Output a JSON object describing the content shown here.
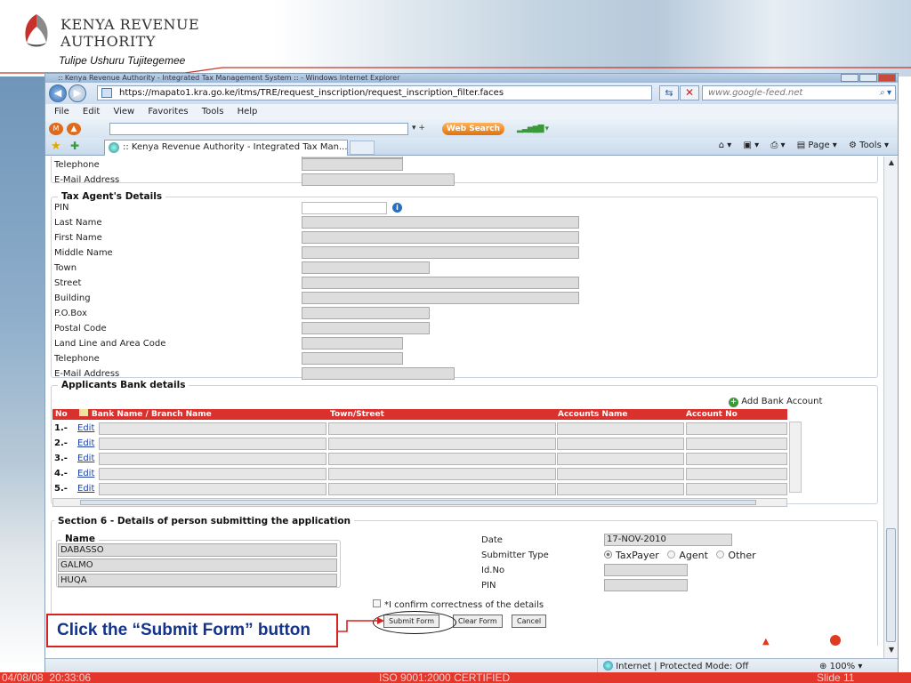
{
  "slide": {
    "org_name_line1": "Kenya Revenue",
    "org_name_line2": "Authority",
    "slogan": "Tulipe Ushuru Tujitegemee",
    "footer_date": "04/08/08",
    "footer_time": "20:33:06",
    "footer_cert": "ISO 9001:2000 CERTIFIED",
    "footer_slide": "Slide 11",
    "callout_text": "Click the “Submit Form” button",
    "brand_color": "#e3372c"
  },
  "browser": {
    "window_title": ":: Kenya Revenue Authority - Integrated Tax Management System :: - Windows Internet Explorer",
    "url": "https://mapato1.kra.go.ke/itms/TRE/request_inscription/request_inscription_filter.faces",
    "search_placeholder": "www.google-feed.net",
    "menu": [
      "File",
      "Edit",
      "View",
      "Favorites",
      "Tools",
      "Help"
    ],
    "web_search_label": "Web Search",
    "tab_title": ":: Kenya Revenue Authority - Integrated Tax Man...",
    "cmd_page": "Page",
    "cmd_tools": "Tools",
    "status_zone": "Internet | Protected Mode: Off",
    "zoom": "100%"
  },
  "form": {
    "prev_section_labels": [
      "Telephone",
      "E-Mail Address"
    ],
    "tax_agent": {
      "legend": "Tax Agent's Details",
      "fields": [
        "PIN",
        "Last Name",
        "First Name",
        "Middle Name",
        "Town",
        "Street",
        "Building",
        "P.O.Box",
        "Postal Code",
        "Land Line and Area Code",
        "Telephone",
        "E-Mail Address"
      ]
    },
    "bank": {
      "legend": "Applicants Bank details",
      "add_label": "Add Bank Account",
      "headers": [
        "No",
        "Bank Name / Branch Name",
        "Town/Street",
        "Accounts Name",
        "Account No"
      ],
      "rows": [
        {
          "no": "1.-",
          "link": "Edit"
        },
        {
          "no": "2.-",
          "link": "Edit"
        },
        {
          "no": "3.-",
          "link": "Edit"
        },
        {
          "no": "4.-",
          "link": "Edit"
        },
        {
          "no": "5.-",
          "link": "Edit"
        }
      ]
    },
    "section6": {
      "legend": "Section 6 - Details of person submitting the application",
      "name_label": "Name",
      "names": [
        "DABASSO",
        "GALMO",
        "HUQA"
      ],
      "date_label": "Date",
      "date_value": "17-NOV-2010",
      "submitter_type_label": "Submitter Type",
      "submitter_options": [
        "TaxPayer",
        "Agent",
        "Other"
      ],
      "submitter_selected": "TaxPayer",
      "id_label": "Id.No",
      "pin_label": "PIN",
      "confirm_label": "*I confirm correctness of the details",
      "submit_label": "Submit Form",
      "clear_label": "Clear Form",
      "cancel_label": "Cancel"
    }
  }
}
